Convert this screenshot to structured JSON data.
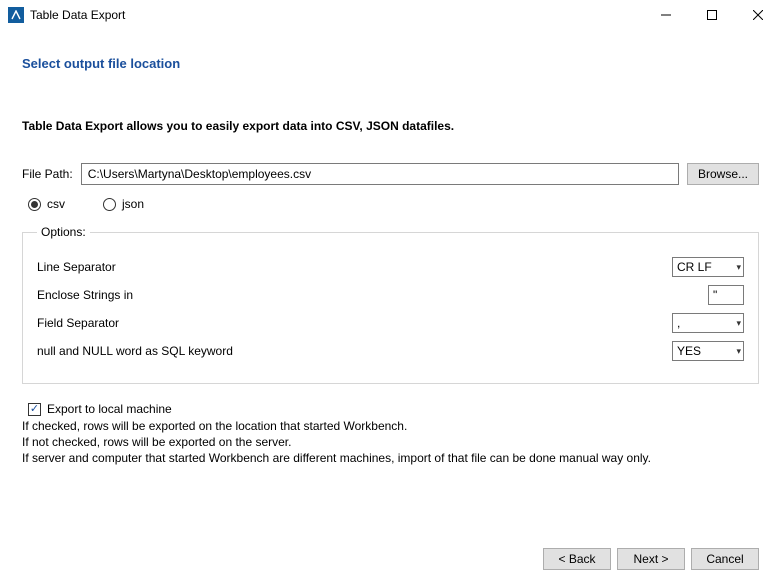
{
  "window": {
    "title": "Table Data Export"
  },
  "heading": "Select output file location",
  "description": "Table Data Export allows you to easily export data into CSV, JSON datafiles.",
  "filepath": {
    "label": "File Path:",
    "value": "C:\\Users\\Martyna\\Desktop\\employees.csv",
    "browse": "Browse..."
  },
  "format": {
    "csv": "csv",
    "json": "json",
    "selected": "csv"
  },
  "options": {
    "legend": "Options:",
    "line_separator": {
      "label": "Line Separator",
      "value": "CR LF"
    },
    "enclose_strings": {
      "label": "Enclose Strings in",
      "value": "\""
    },
    "field_separator": {
      "label": "Field Separator",
      "value": ","
    },
    "null_keyword": {
      "label": "null and NULL word as SQL keyword",
      "value": "YES"
    }
  },
  "export_local": {
    "label": "Export to local machine",
    "checked": true,
    "help1": "If checked, rows will be exported on the location that started Workbench.",
    "help2": "If not checked, rows will be exported on the server.",
    "help3": "If server and computer that started Workbench are different machines, import of that file can be done manual way only."
  },
  "footer": {
    "back": "< Back",
    "next": "Next >",
    "cancel": "Cancel"
  }
}
